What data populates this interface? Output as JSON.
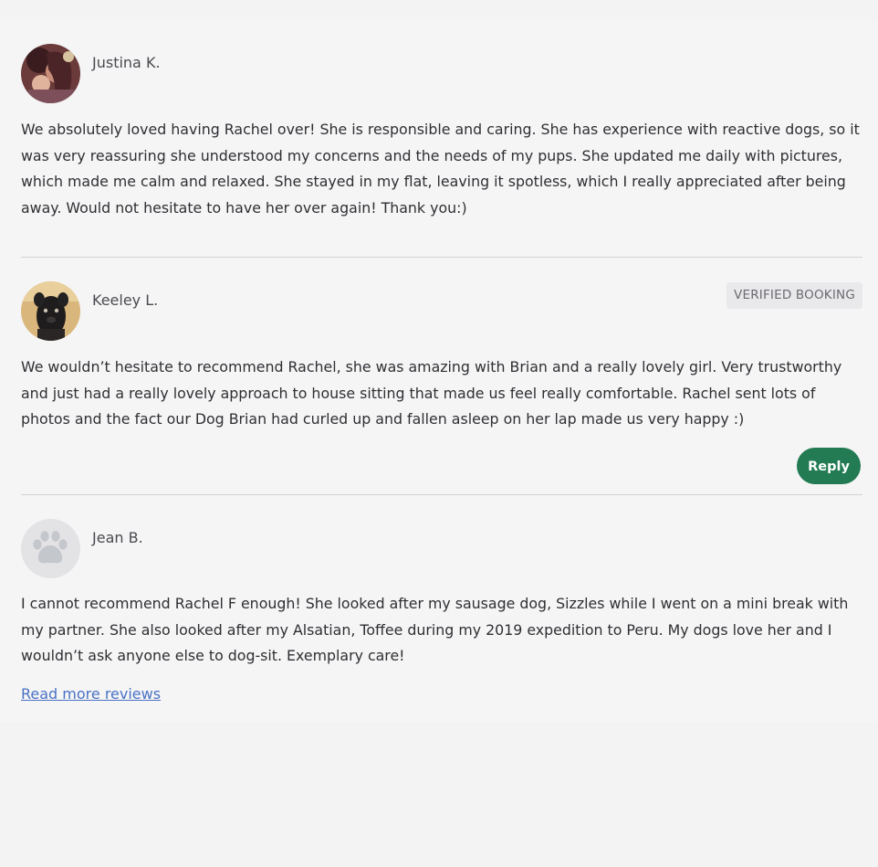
{
  "reviews": [
    {
      "name": "Justina K.",
      "avatar": "user-photo",
      "badge": "",
      "text": "We absolutely loved having Rachel over! She is responsible and caring. She has experience with reactive dogs, so it was very reassuring she understood my concerns and the needs of my pups. She updated me daily with pictures, which made me calm and relaxed. She stayed in my flat, leaving it spotless, which I really appreciated after being away. Would not hesitate to have her over again! Thank you:)"
    },
    {
      "name": "Keeley L.",
      "avatar": "dog-photo",
      "badge": "VERIFIED BOOKING",
      "text": "We wouldn’t hesitate to recommend Rachel, she was amazing with Brian and a really lovely girl. Very trustworthy and just had a really lovely approach to house sitting that made us feel really comfortable. Rachel sent lots of photos and the fact our Dog Brian had curled up and fallen asleep on her lap made us very happy :)",
      "reply_label": "Reply"
    },
    {
      "name": "Jean B.",
      "avatar": "paw-icon",
      "badge": "",
      "text": "I cannot recommend Rachel F enough! She looked after my sausage dog, Sizzles while I went on a mini break with my partner. She also looked after my Alsatian, Toffee during my 2019 expedition to Peru. My dogs love her and I wouldn’t ask anyone else to dog-sit. Exemplary care!"
    }
  ],
  "read_more_label": "Read more reviews",
  "colors": {
    "reply_button": "#227b52",
    "link": "#4a72c4",
    "badge_bg": "#e9e9eb"
  }
}
